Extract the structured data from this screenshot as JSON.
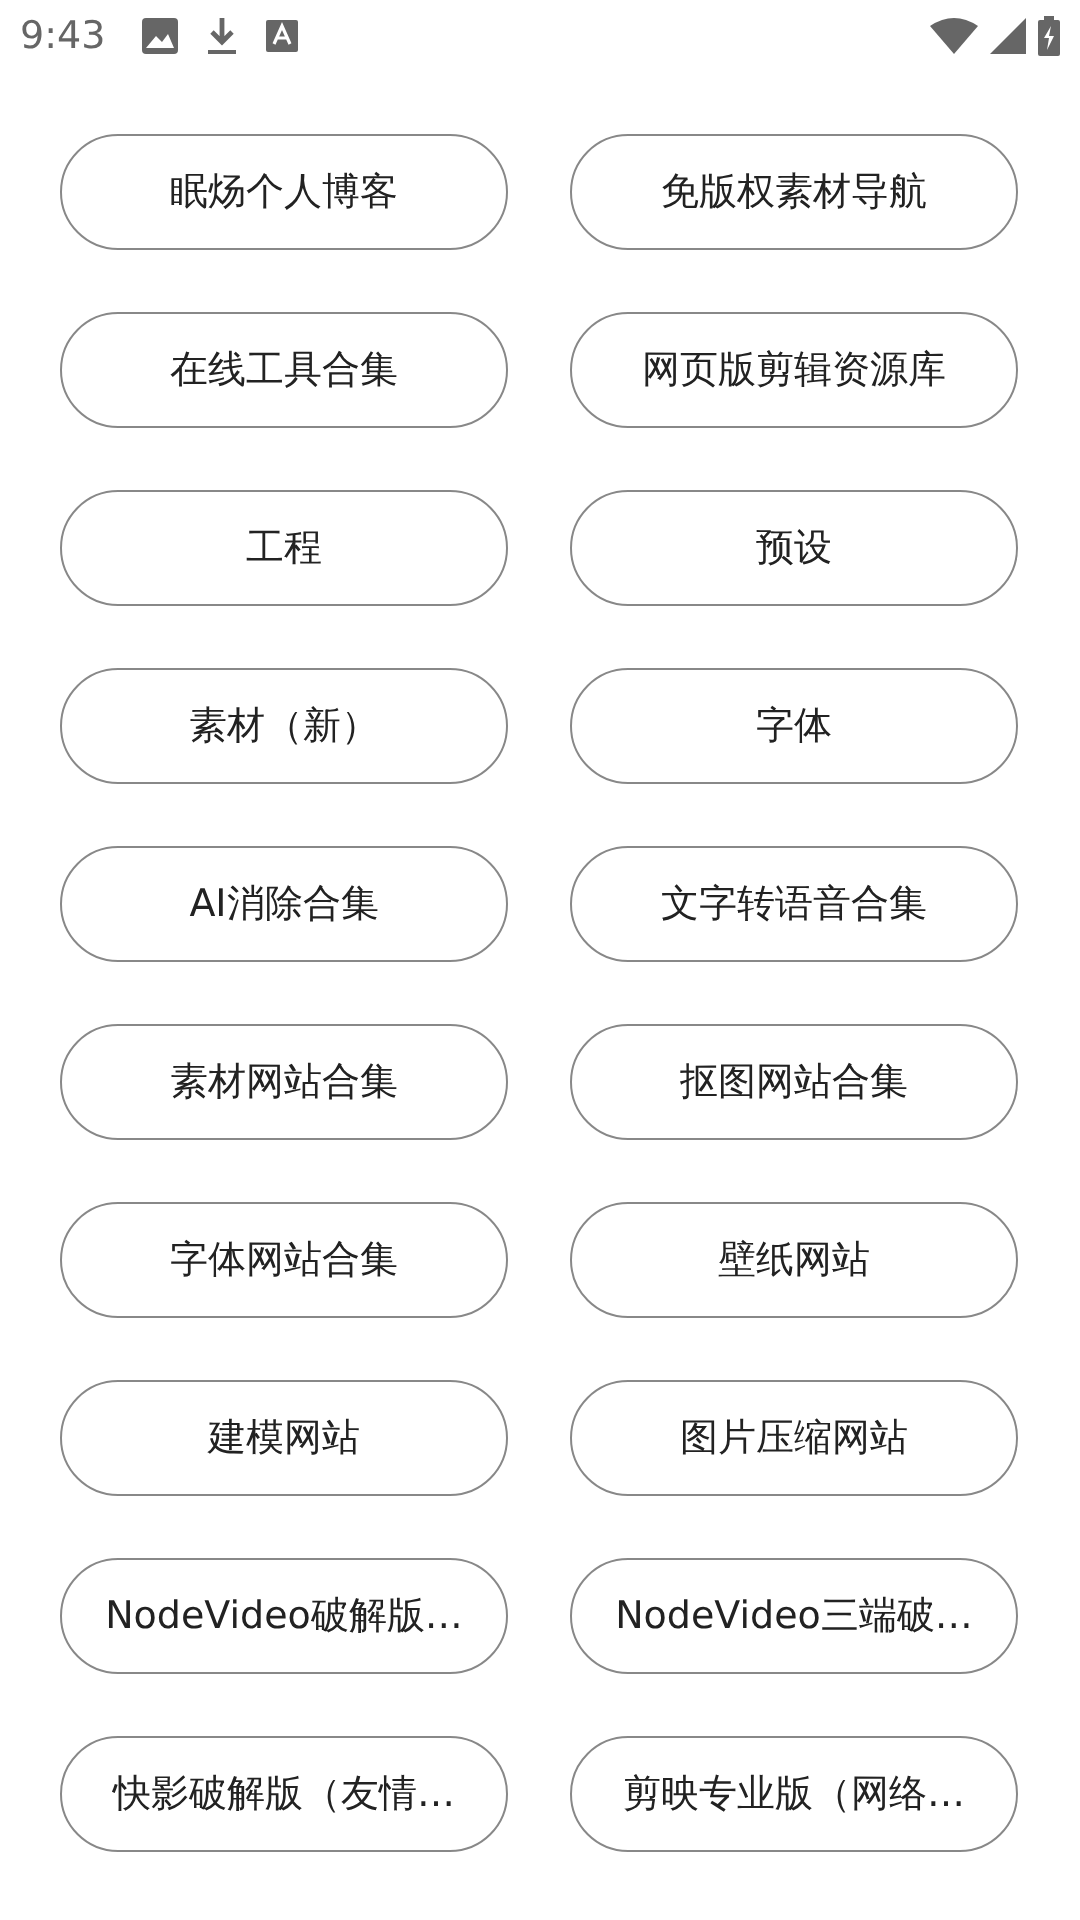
{
  "status_bar": {
    "time": "9:43"
  },
  "links": [
    {
      "label": "眠炀个人博客"
    },
    {
      "label": "免版权素材导航"
    },
    {
      "label": "在线工具合集"
    },
    {
      "label": "网页版剪辑资源库"
    },
    {
      "label": "工程"
    },
    {
      "label": "预设"
    },
    {
      "label": "素材（新）"
    },
    {
      "label": "字体"
    },
    {
      "label": "AI消除合集"
    },
    {
      "label": "文字转语音合集"
    },
    {
      "label": "素材网站合集"
    },
    {
      "label": "抠图网站合集"
    },
    {
      "label": "字体网站合集"
    },
    {
      "label": "壁纸网站"
    },
    {
      "label": "建模网站"
    },
    {
      "label": "图片压缩网站"
    },
    {
      "label": "NodeVideo破解版…"
    },
    {
      "label": "NodeVideo三端破…"
    },
    {
      "label": "快影破解版（友情…"
    },
    {
      "label": "剪映专业版（网络…"
    }
  ]
}
